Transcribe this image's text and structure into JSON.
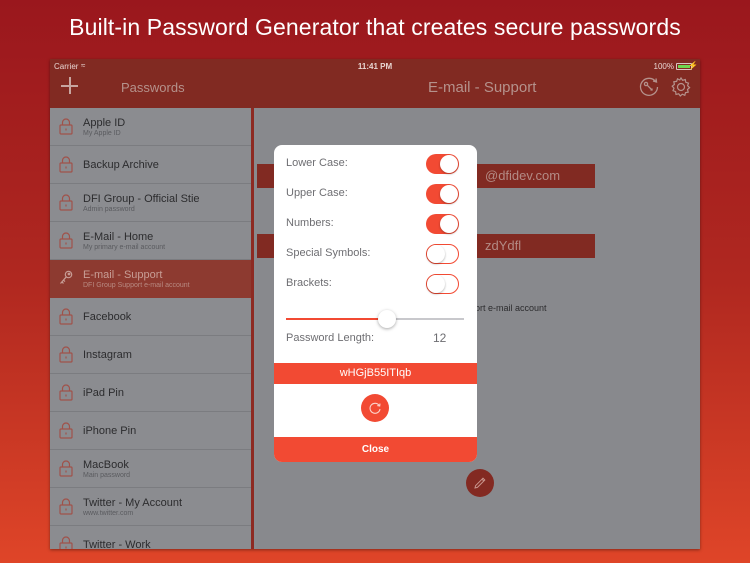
{
  "headline": "Built-in Password Generator that creates secure passwords",
  "status_bar": {
    "carrier": "Carrier",
    "time": "11:41 PM",
    "battery": "100%"
  },
  "navbar": {
    "left_title": "Passwords",
    "title": "E-mail - Support",
    "icons": [
      "add-icon",
      "password-generator-icon",
      "gear-icon"
    ]
  },
  "sidebar": {
    "items": [
      {
        "title": "Apple ID",
        "subtitle": "My Apple ID",
        "icon": "lock-icon"
      },
      {
        "title": "Backup Archive",
        "subtitle": "",
        "icon": "lock-icon"
      },
      {
        "title": "DFI Group - Official Stie",
        "subtitle": "Admin password",
        "icon": "lock-icon"
      },
      {
        "title": "E-Mail - Home",
        "subtitle": "My primary e-mail account",
        "icon": "lock-icon"
      },
      {
        "title": "E-mail - Support",
        "subtitle": "DFI Group Support e-mail account",
        "icon": "key-icon",
        "active": true
      },
      {
        "title": "Facebook",
        "subtitle": "",
        "icon": "lock-icon"
      },
      {
        "title": "Instagram",
        "subtitle": "",
        "icon": "lock-icon"
      },
      {
        "title": "iPad Pin",
        "subtitle": "",
        "icon": "lock-icon"
      },
      {
        "title": "iPhone Pin",
        "subtitle": "",
        "icon": "lock-icon"
      },
      {
        "title": "MacBook",
        "subtitle": "Main password",
        "icon": "lock-icon"
      },
      {
        "title": "Twitter - My Account",
        "subtitle": "www.twitter.com",
        "icon": "lock-icon"
      },
      {
        "title": "Twitter - Work",
        "subtitle": "",
        "icon": "lock-icon"
      }
    ]
  },
  "detail": {
    "field1_partial": "@dfidev.com",
    "field2_partial": "zdYdfl",
    "note_partial": "ort e-mail account"
  },
  "generator": {
    "options": [
      {
        "label": "Lower Case:",
        "on": true
      },
      {
        "label": "Upper Case:",
        "on": true
      },
      {
        "label": "Numbers:",
        "on": true
      },
      {
        "label": "Special Symbols:",
        "on": false
      },
      {
        "label": "Brackets:",
        "on": false
      }
    ],
    "length_label": "Password Length:",
    "length_value": "12",
    "slider_fraction": 0.57,
    "generated_password": "wHGjB55ITIqb",
    "close_label": "Close"
  },
  "colors": {
    "accent": "#f24a33",
    "nav": "#812a22"
  }
}
